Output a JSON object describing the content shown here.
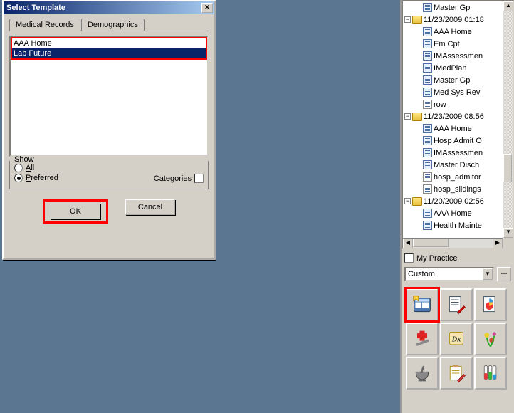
{
  "dialog": {
    "title": "Select Template",
    "tabs": {
      "medical": "Medical Records",
      "demographics": "Demographics"
    },
    "list": {
      "item_aaa": "AAA Home",
      "item_lab": "Lab Future"
    },
    "show": {
      "legend": "Show",
      "all": "All",
      "preferred": "Preferred",
      "categories": "Categories"
    },
    "buttons": {
      "ok": "OK",
      "cancel": "Cancel"
    }
  },
  "tree": {
    "n0_label": "Master Gp",
    "n1_label": "11/23/2009 01:18",
    "n1c": {
      "c0": "AAA Home",
      "c1": "Em Cpt",
      "c2": "IMAssessmen",
      "c3": "IMedPlan",
      "c4": "Master Gp",
      "c5": "Med Sys Rev",
      "c6": "row"
    },
    "n2_label": "11/23/2009 08:56",
    "n2c": {
      "c0": "AAA Home",
      "c1": "Hosp Admit O",
      "c2": "IMAssessmen",
      "c3": "Master Disch",
      "c4": "hosp_admitor",
      "c5": "hosp_slidings"
    },
    "n3_label": "11/20/2009 02:56",
    "n3c": {
      "c0": "AAA Home",
      "c1": "Health Mainte"
    }
  },
  "right": {
    "practice": "My Practice",
    "combo": "Custom",
    "ellipsis": "..."
  },
  "icons": {
    "grid0": "template-grid-icon",
    "grid1": "doc-pen-icon",
    "grid2": "pie-doc-icon",
    "grid3": "medical-cross-icon",
    "grid4": "dx-scroll-icon",
    "grid5": "flowers-icon",
    "grid6": "mortar-pestle-icon",
    "grid7": "clipboard-pen-icon",
    "grid8": "test-tubes-icon"
  },
  "chart_data": {
    "type": "table",
    "note": "no chart present"
  }
}
